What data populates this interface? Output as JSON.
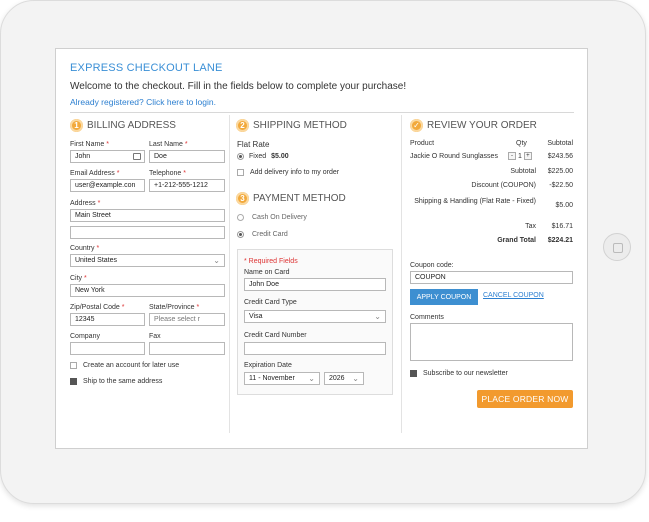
{
  "header": {
    "title": "EXPRESS CHECKOUT LANE",
    "welcome": "Welcome to the checkout. Fill in the fields below to complete your purchase!",
    "login_link": "Already registered? Click here to login."
  },
  "billing": {
    "step": "1",
    "title": "BILLING ADDRESS",
    "first_name_label": "First Name",
    "first_name": "John",
    "last_name_label": "Last Name",
    "last_name": "Doe",
    "email_label": "Email Address",
    "email": "user@example.con",
    "telephone_label": "Telephone",
    "telephone": "+1-212-555-1212",
    "address_label": "Address",
    "address1": "Main Street",
    "address2": "",
    "country_label": "Country",
    "country": "United States",
    "city_label": "City",
    "city": "New York",
    "zip_label": "Zip/Postal Code",
    "zip": "12345",
    "state_label": "State/Province",
    "state": "Please select r",
    "company_label": "Company",
    "company": "",
    "fax_label": "Fax",
    "fax": "",
    "create_account_label": "Create an account for later use",
    "ship_same_label": "Ship to the same address",
    "create_account_checked": false,
    "ship_same_checked": true,
    "required_mark": "*"
  },
  "shipping": {
    "step": "2",
    "title": "SHIPPING METHOD",
    "flat_rate_label": "Flat Rate",
    "fixed_label": "Fixed",
    "fixed_price": "$5.00",
    "delivery_info_label": "Add delivery info to my order"
  },
  "payment": {
    "step": "3",
    "title": "PAYMENT METHOD",
    "cod_label": "Cash On Delivery",
    "cc_label": "Credit Card",
    "required_fields": "* Required Fields",
    "name_on_card_label": "Name on Card",
    "name_on_card": "John Doe",
    "card_type_label": "Credit Card Type",
    "card_type": "Visa",
    "card_number_label": "Credit Card Number",
    "card_number": "",
    "expiration_label": "Expiration Date",
    "exp_month": "11 - November",
    "exp_year": "2026"
  },
  "review": {
    "title": "REVIEW YOUR ORDER",
    "col_product": "Product",
    "col_qty": "Qty",
    "col_subtotal": "Subtotal",
    "item_name": "Jackie O Round Sunglasses",
    "item_qty": "1",
    "item_subtotal": "$243.56",
    "subtotal_label": "Subtotal",
    "subtotal_value": "$225.00",
    "discount_label": "Discount (COUPON)",
    "discount_value": "-$22.50",
    "shipping_label": "Shipping & Handling (Flat Rate - Fixed)",
    "shipping_value": "$5.00",
    "tax_label": "Tax",
    "tax_value": "$16.71",
    "grand_total_label": "Grand Total",
    "grand_total_value": "$224.21",
    "minus": "-",
    "plus": "+",
    "coupon_label": "Coupon code:",
    "coupon_value": "COUPON",
    "apply_coupon": "APPLY COUPON",
    "cancel_coupon": "CANCEL COUPON",
    "comments_label": "Comments",
    "newsletter_label": "Subscribe to our newsletter",
    "place_order": "PLACE ORDER NOW"
  },
  "colors": {
    "accent_blue": "#3a8fd6",
    "accent_orange": "#f29a2e",
    "step_badge": "#f2a93b"
  },
  "icons": {
    "contact_card": "contact-card-icon",
    "select_caret": "chevron-down-icon",
    "review_check": "check-circle-icon"
  }
}
